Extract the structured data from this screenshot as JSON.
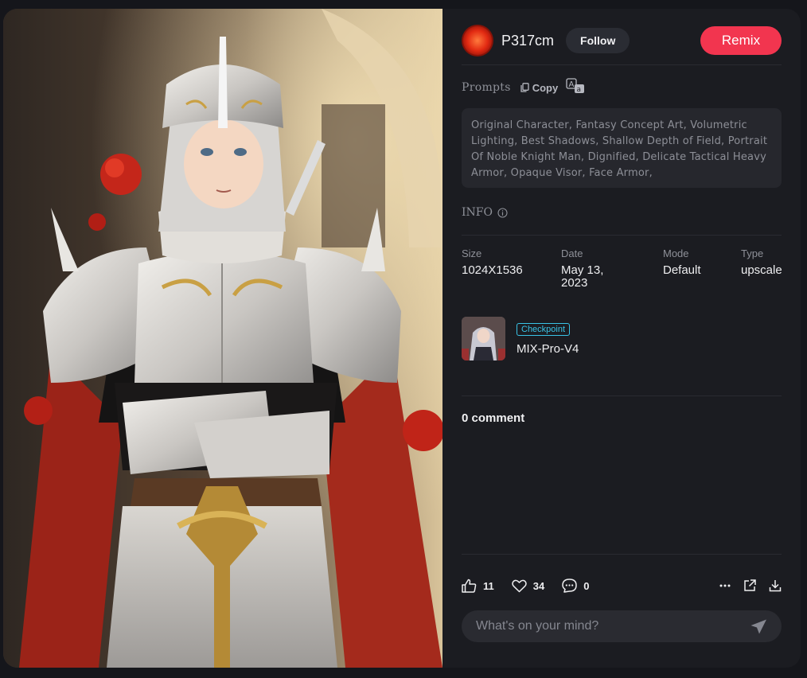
{
  "author": {
    "name": "P317cm",
    "follow_label": "Follow"
  },
  "remix_label": "Remix",
  "prompts": {
    "label": "Prompts",
    "copy_label": "Copy",
    "text": "Original Character, Fantasy Concept Art, Volumetric Lighting, Best Shadows, Shallow Depth of Field, Portrait Of Noble Knight Man, Dignified, Delicate Tactical Heavy Armor, Opaque Visor, Face Armor,"
  },
  "info": {
    "label": "INFO",
    "fields": [
      {
        "key": "Size",
        "value": "1024X1536"
      },
      {
        "key": "Date",
        "value": "May 13, 2023"
      },
      {
        "key": "Mode",
        "value": "Default"
      },
      {
        "key": "Type",
        "value": "upscale"
      }
    ]
  },
  "model": {
    "badge": "Checkpoint",
    "name": "MIX-Pro-V4"
  },
  "comments": {
    "title": "0 comment",
    "placeholder": "What's on your mind?"
  },
  "stats": {
    "likes": "11",
    "favorites": "34",
    "comments": "0"
  },
  "icons": {
    "copy": "copy-icon",
    "translate": "translate-icon",
    "info": "info-icon",
    "like": "thumbs-up-icon",
    "favorite": "heart-icon",
    "comment": "comment-icon",
    "more": "more-icon",
    "share": "share-icon",
    "download": "download-icon",
    "send": "send-icon"
  },
  "colors": {
    "accent": "#f2354f",
    "badge": "#39c3e6",
    "panel": "#1b1c21",
    "background": "#15161b"
  }
}
